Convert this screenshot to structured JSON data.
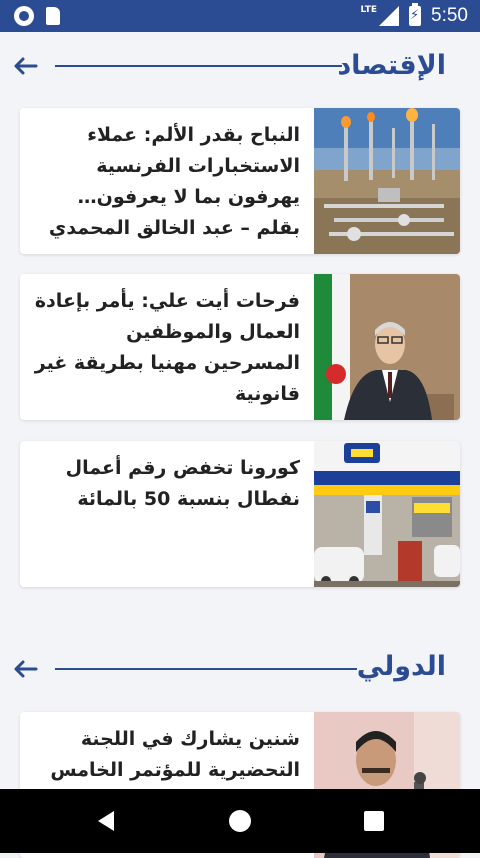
{
  "status_bar": {
    "network": "LTE",
    "time": "5:50",
    "icons": [
      "notification-circle-icon",
      "sd-card-icon",
      "signal-icon",
      "battery-charging-icon"
    ]
  },
  "sections": [
    {
      "title": "الإقتصاد",
      "articles": [
        {
          "title": "النباح بقدر الألم: عملاء الاستخبارات الفرنسية يهرفون بما لا يعرفون… بقلم – عبد الخالق المحمدي"
        },
        {
          "title": "فرحات أيت علي: يأمر بإعادة العمال والموظفين المسرحين مهنيا بطريقة غير قانونية"
        },
        {
          "title": "كورونا تخفض رقم أعمال نفطال بنسبة 50 بالمائة"
        }
      ]
    },
    {
      "title": "الدولي",
      "articles": [
        {
          "title": "شنين يشارك في اللجنة التحضيرية للمؤتمر الخامس لرؤساء البرلمانات"
        }
      ]
    }
  ],
  "nav_bar": {
    "icons": [
      "back-triangle-icon",
      "home-circle-icon",
      "recents-square-icon"
    ]
  },
  "colors": {
    "accent": "#2b4c93",
    "background": "#f3f4f8"
  }
}
